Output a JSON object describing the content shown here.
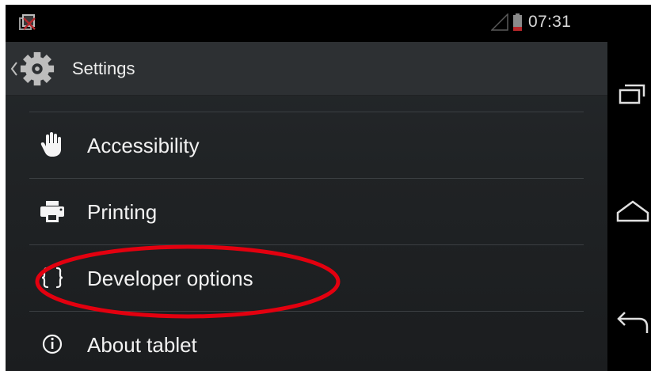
{
  "status_bar": {
    "time": "07:31",
    "notification_icon": "screenshot-notification-icon",
    "signal_icon": "signal-icon",
    "battery_icon": "battery-icon"
  },
  "action_bar": {
    "title": "Settings",
    "up_icon": "back-caret-icon",
    "app_icon": "settings-gear-icon"
  },
  "settings_list": [
    {
      "label": "Accessibility",
      "icon": "hand-icon"
    },
    {
      "label": "Printing",
      "icon": "printer-icon"
    },
    {
      "label": "Developer options",
      "icon": "braces-icon",
      "highlighted": true
    },
    {
      "label": "About tablet",
      "icon": "info-icon"
    }
  ],
  "nav_bar": {
    "buttons": [
      "recent-apps-icon",
      "home-icon",
      "back-icon"
    ]
  },
  "colors": {
    "background": "#202325",
    "status_bar": "#000000",
    "action_bar": "#2d3033",
    "divider": "#3b3f42",
    "text": "#f2f2f2",
    "annotation": "#e3000f"
  }
}
